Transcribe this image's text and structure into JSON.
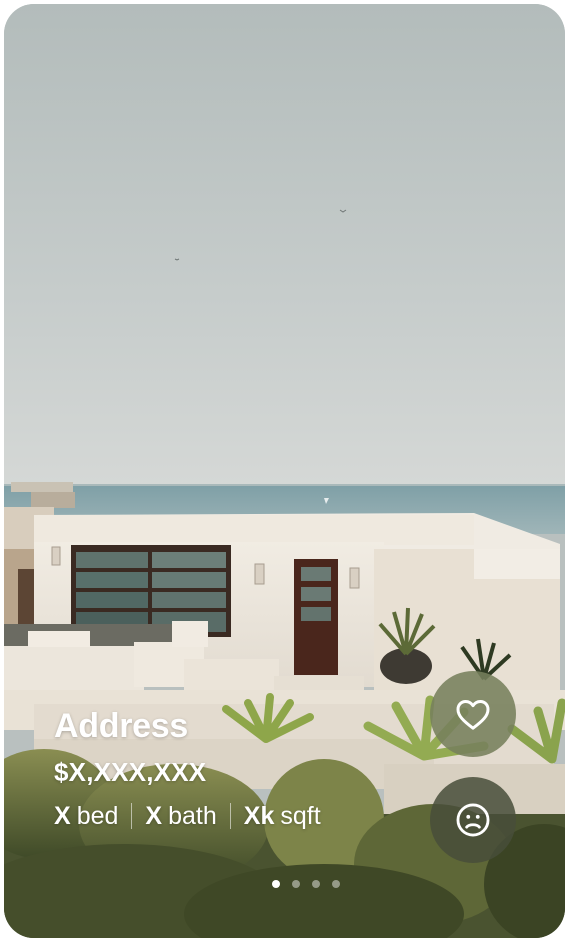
{
  "listing": {
    "address": "Address",
    "price": "$X,XXX,XXX",
    "beds_value": "X",
    "beds_unit": "bed",
    "baths_value": "X",
    "baths_unit": "bath",
    "sqft_value": "Xk",
    "sqft_unit": "sqft"
  },
  "actions": {
    "like_icon": "heart-icon",
    "dislike_icon": "frown-face-icon"
  },
  "pagination": {
    "total": 4,
    "active_index": 0
  },
  "colors": {
    "like_button": "#76805C",
    "dislike_button": "#484E3A",
    "text": "#FFFFFF"
  }
}
